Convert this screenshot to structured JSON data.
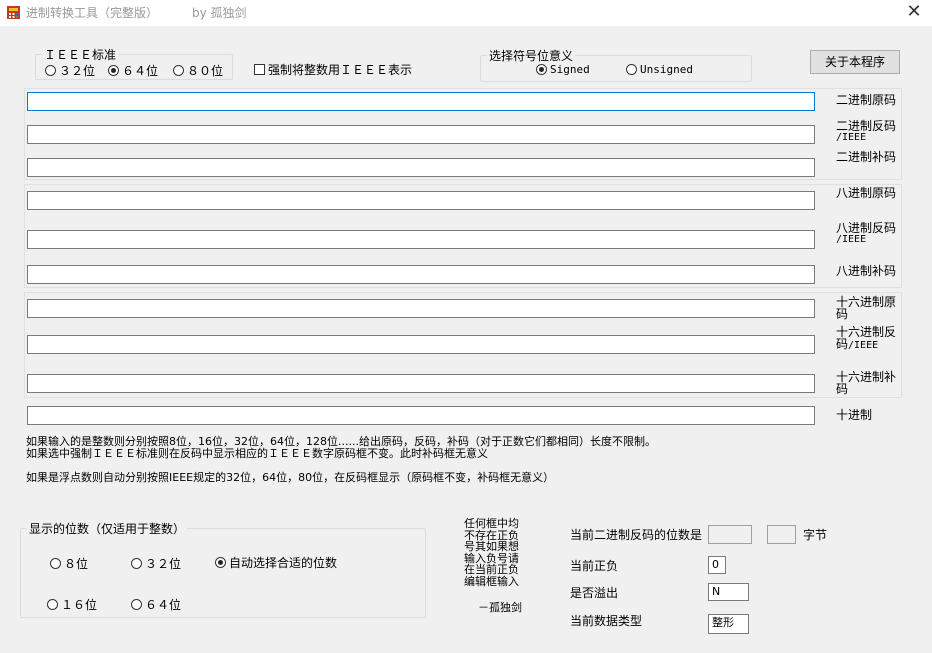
{
  "window": {
    "title": "进制转换工具（完整版）",
    "author": "by 孤独剑",
    "close_icon": "close-icon"
  },
  "ieee": {
    "legend": "ＩＥＥＥ标准",
    "options": [
      "３２位",
      "６４位",
      "８０位"
    ],
    "selected": 1
  },
  "force_ieee": {
    "label": "强制将整数用ＩＥＥＥ表示",
    "checked": false
  },
  "sign": {
    "legend": "选择符号位意义",
    "options": [
      "Signed",
      "Unsigned"
    ],
    "selected": 0
  },
  "about_button": "关于本程序",
  "binary": {
    "original": {
      "label": "二进制原码",
      "value": ""
    },
    "ones": {
      "label": "二进制反码",
      "sub": "/IEEE",
      "value": ""
    },
    "twos": {
      "label": "二进制补码",
      "value": ""
    }
  },
  "octal": {
    "original": {
      "label": "八进制原码",
      "value": ""
    },
    "ones": {
      "label": "八进制反码",
      "sub": "/IEEE",
      "value": ""
    },
    "twos": {
      "label": "八进制补码",
      "value": ""
    }
  },
  "hex": {
    "original": {
      "label1": "十六进制原",
      "label2": "码",
      "value": ""
    },
    "ones": {
      "label1": "十六进制反",
      "label2": "码",
      "sub": "/IEEE",
      "value": ""
    },
    "twos": {
      "label1": "十六进制补",
      "label2": "码",
      "value": ""
    }
  },
  "decimal": {
    "label": "十进制",
    "value": ""
  },
  "notes": {
    "line1": "如果输入的是整数则分别按照8位，16位，32位，64位，128位......给出原码，反码，补码（对于正数它们都相同）长度不限制。",
    "line2": "如果选中强制ＩＥＥＥ标准则在反码中显示相应的ＩＥＥＥ数字原码框不变。此时补码框无意义",
    "line3": "如果是浮点数则自动分别按照IEEE规定的32位，64位，80位，在反码框显示（原码框不变，补码框无意义）"
  },
  "digits": {
    "legend": "显示的位数（仅适用于整数）",
    "options": [
      "８位",
      "３２位",
      "自动选择合适的位数",
      "１６位",
      "６４位"
    ],
    "selected": 2
  },
  "hint": {
    "lines": [
      "任何框中均",
      "不存在正负",
      "号其如果想",
      "输入负号请",
      "在当前正负",
      "编辑框输入"
    ],
    "sign_off": "－孤独剑"
  },
  "status": {
    "bits_label": "当前二进制反码的位数是",
    "bits_value": "",
    "bytes_value": "",
    "bytes_unit": "字节",
    "sign_label": "当前正负",
    "sign_value": "0",
    "overflow_label": "是否溢出",
    "overflow_value": "N",
    "type_label": "当前数据类型",
    "type_value": "整形"
  }
}
